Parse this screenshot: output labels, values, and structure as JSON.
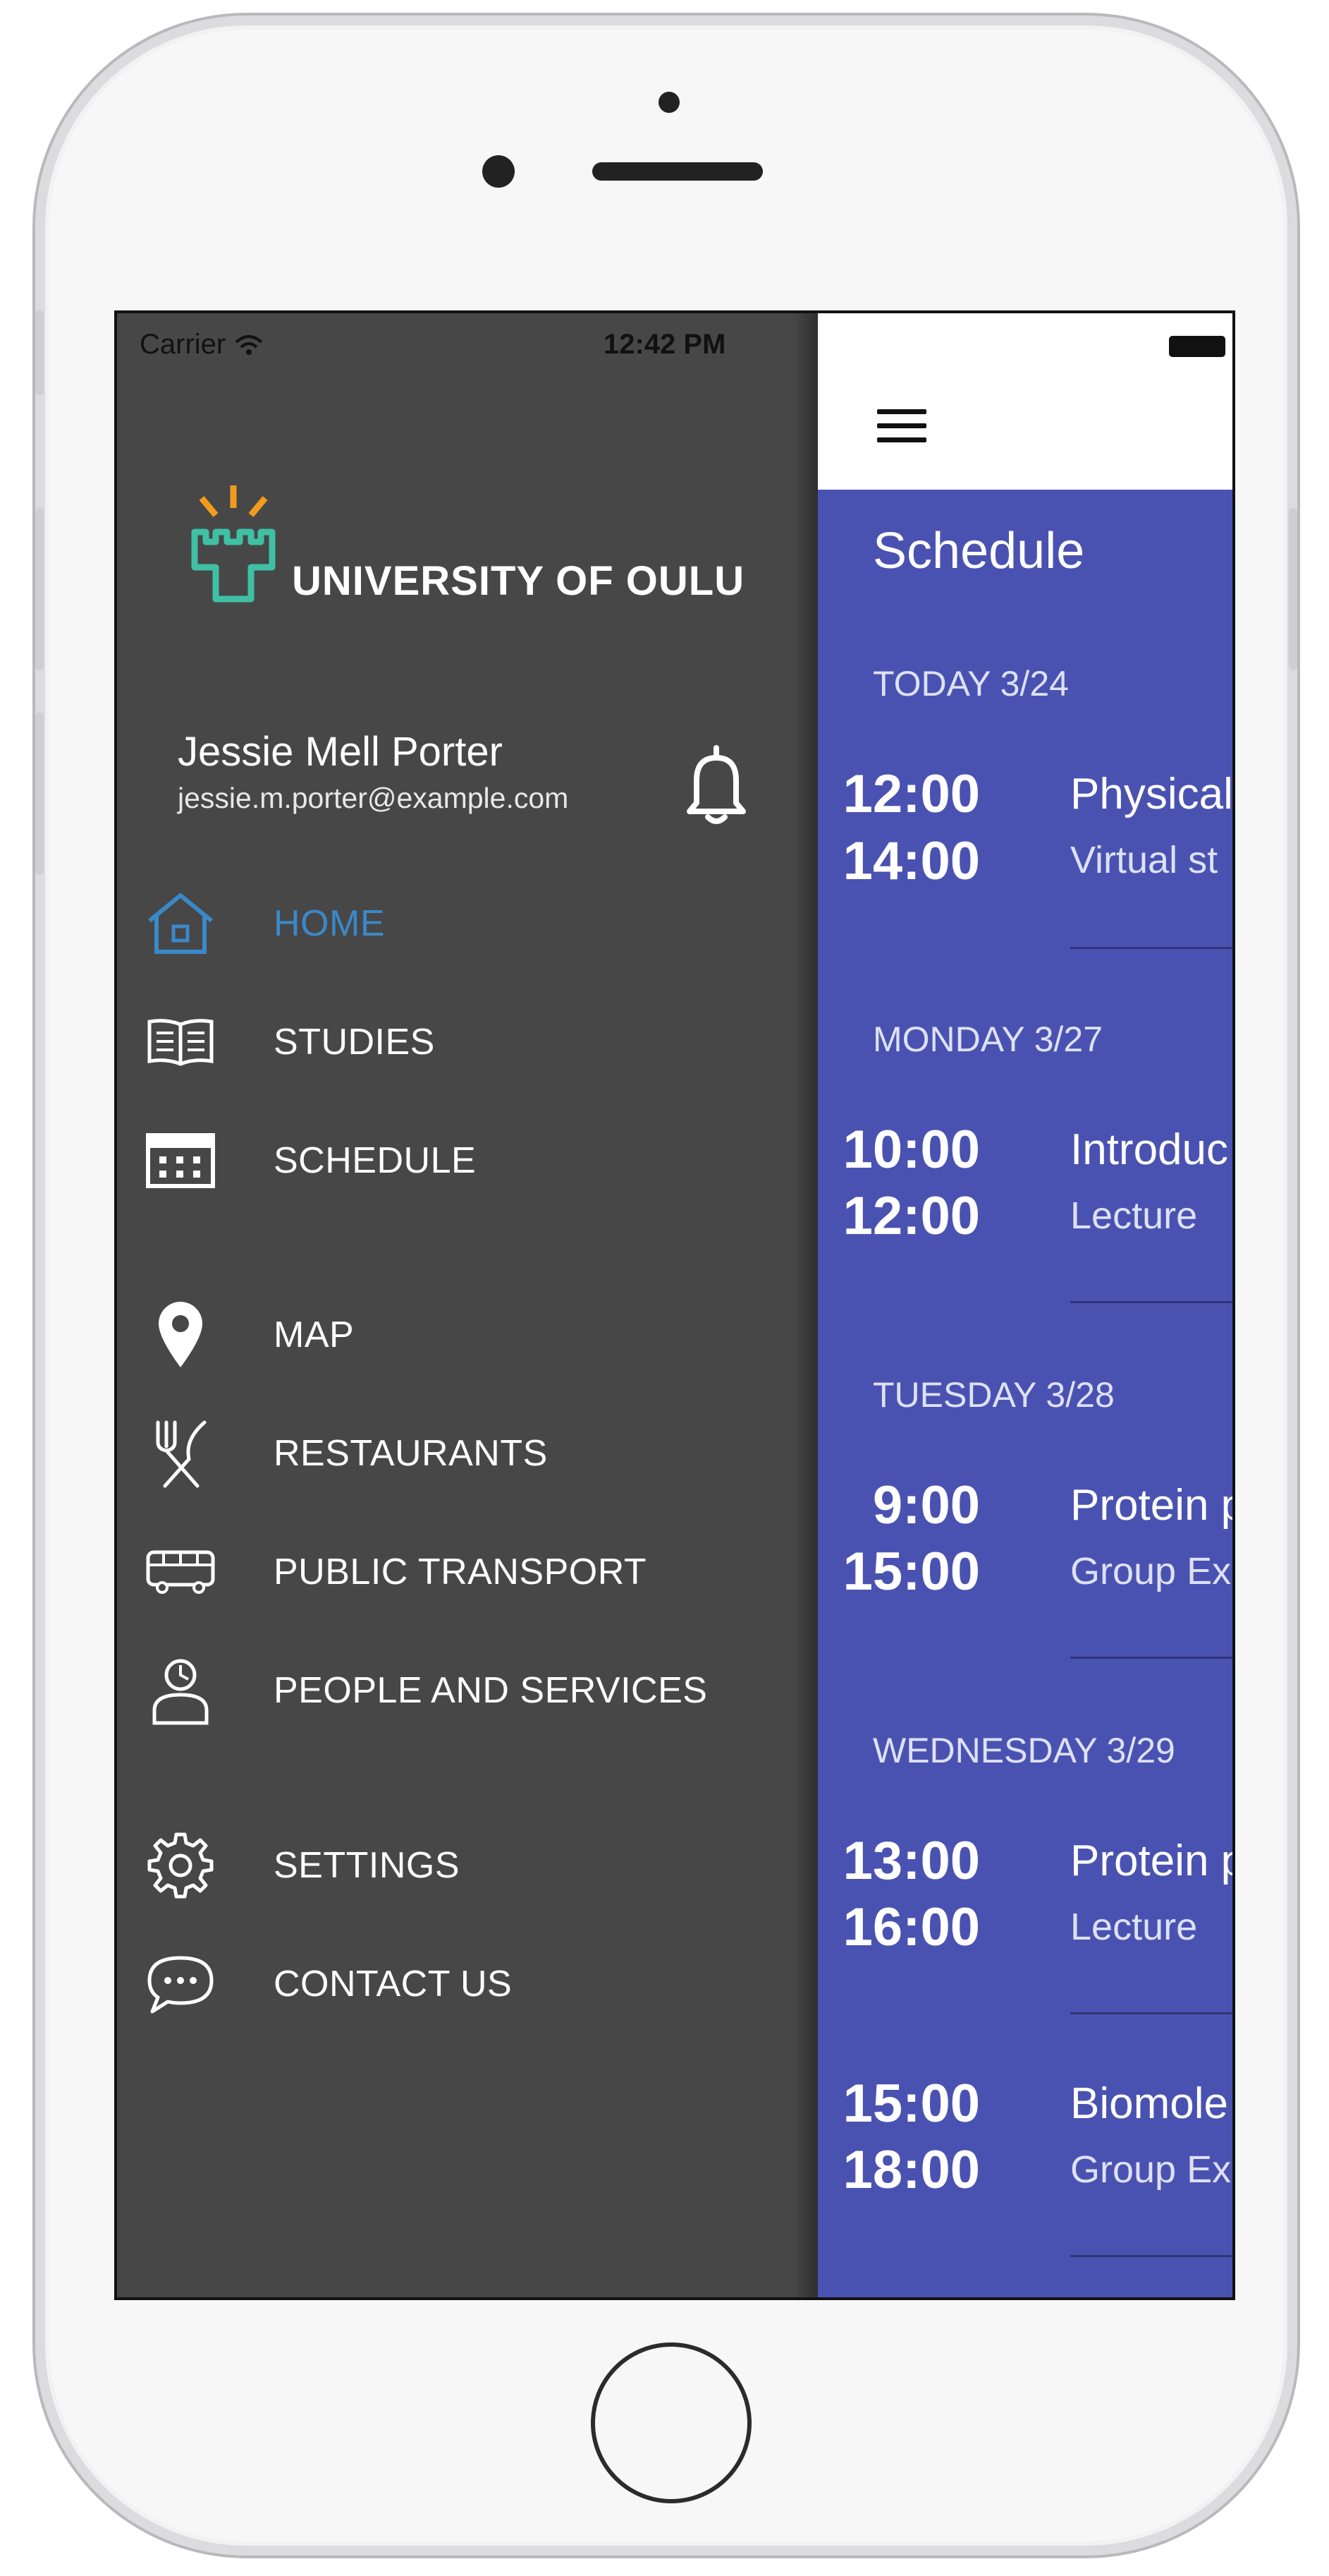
{
  "status_bar": {
    "carrier": "Carrier",
    "time": "12:42 PM"
  },
  "drawer": {
    "university": "UNIVERSITY OF OULU",
    "user_name": "Jessie Mell Porter",
    "user_email": "jessie.m.porter@example.com",
    "menu": [
      {
        "label": "HOME",
        "icon": "home-icon",
        "active": true
      },
      {
        "label": "STUDIES",
        "icon": "book-icon"
      },
      {
        "label": "SCHEDULE",
        "icon": "calendar-icon"
      },
      {
        "label": "MAP",
        "icon": "map-pin-icon"
      },
      {
        "label": "RESTAURANTS",
        "icon": "fork-knife-icon"
      },
      {
        "label": "PUBLIC TRANSPORT",
        "icon": "bus-icon"
      },
      {
        "label": "PEOPLE AND SERVICES",
        "icon": "person-icon"
      },
      {
        "label": "SETTINGS",
        "icon": "gear-icon"
      },
      {
        "label": "CONTACT US",
        "icon": "chat-bubble-icon"
      }
    ]
  },
  "main": {
    "title": "Schedule",
    "days": [
      {
        "label": "TODAY 3/24",
        "events": [
          {
            "start": "12:00",
            "end": "14:00",
            "title": "Physical",
            "sub": "Virtual st"
          }
        ]
      },
      {
        "label": "MONDAY 3/27",
        "events": [
          {
            "start": "10:00",
            "end": "12:00",
            "title": "Introduc",
            "sub": "Lecture"
          }
        ]
      },
      {
        "label": "TUESDAY 3/28",
        "events": [
          {
            "start": "9:00",
            "end": "15:00",
            "title": "Protein p",
            "sub": "Group Ex"
          }
        ]
      },
      {
        "label": "WEDNESDAY 3/29",
        "events": [
          {
            "start": "13:00",
            "end": "16:00",
            "title": "Protein p",
            "sub": "Lecture"
          },
          {
            "start": "15:00",
            "end": "18:00",
            "title": "Biomole",
            "sub": "Group Ex"
          }
        ]
      }
    ]
  },
  "colors": {
    "drawer_bg": "#474747",
    "active": "#3a89c9",
    "main_bg": "#4a52b1",
    "logo_orange": "#f29b1f",
    "logo_teal": "#3fc0a5"
  }
}
